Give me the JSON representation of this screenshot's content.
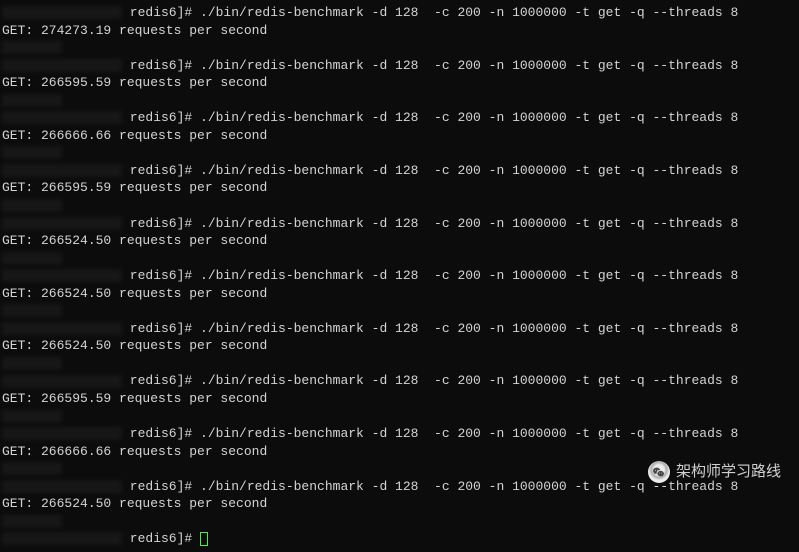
{
  "prompt_prefix": " redis6]# ",
  "command": "./bin/redis-benchmark -d 128  -c 200 -n 1000000 -t get -q --threads 8",
  "runs": [
    {
      "result": "GET: 274273.19 requests per second"
    },
    {
      "result": "GET: 266595.59 requests per second"
    },
    {
      "result": "GET: 266666.66 requests per second"
    },
    {
      "result": "GET: 266595.59 requests per second"
    },
    {
      "result": "GET: 266524.50 requests per second"
    },
    {
      "result": "GET: 266524.50 requests per second"
    },
    {
      "result": "GET: 266524.50 requests per second"
    },
    {
      "result": "GET: 266595.59 requests per second"
    },
    {
      "result": "GET: 266666.66 requests per second"
    },
    {
      "result": "GET: 266524.50 requests per second"
    }
  ],
  "final_prompt": " redis6]# ",
  "watermark": "架构师学习路线"
}
